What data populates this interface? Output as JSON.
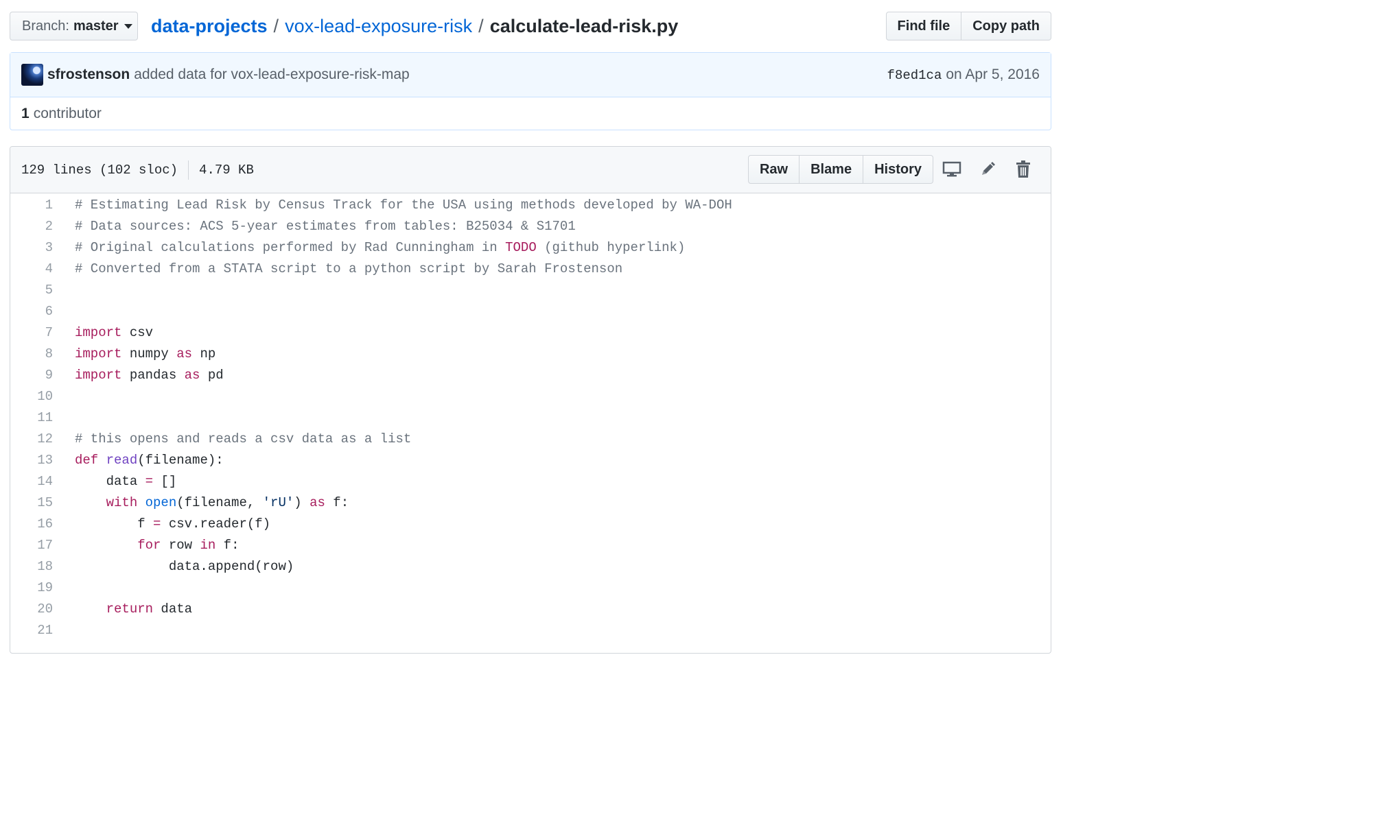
{
  "branch": {
    "label": "Branch:",
    "value": "master"
  },
  "breadcrumb": {
    "repo": "data-projects",
    "folder": "vox-lead-exposure-risk",
    "file": "calculate-lead-risk.py",
    "sep": "/"
  },
  "file_nav": {
    "find_file": "Find file",
    "copy_path": "Copy path"
  },
  "commit": {
    "author": "sfrostenson",
    "message": "added data for vox-lead-exposure-risk-map",
    "sha": "f8ed1ca",
    "date": "on Apr 5, 2016"
  },
  "contributors": {
    "count": "1",
    "label": "contributor"
  },
  "file": {
    "lines": "129 lines (102 sloc)",
    "size": "4.79 KB",
    "actions": {
      "raw": "Raw",
      "blame": "Blame",
      "history": "History"
    },
    "icons": [
      "desktop-icon",
      "pencil-icon",
      "trash-icon"
    ]
  },
  "code": [
    {
      "n": "1",
      "tokens": [
        {
          "t": "# Estimating Lead Risk by Census Track for the USA using methods developed by WA-DOH",
          "c": "comment"
        }
      ]
    },
    {
      "n": "2",
      "tokens": [
        {
          "t": "# Data sources: ACS 5-year estimates from tables: B25034 & S1701",
          "c": "comment"
        }
      ]
    },
    {
      "n": "3",
      "tokens": [
        {
          "t": "# Original calculations performed by Rad Cunningham in ",
          "c": "comment"
        },
        {
          "t": "TODO",
          "c": "todo"
        },
        {
          "t": " (github hyperlink)",
          "c": "comment"
        }
      ]
    },
    {
      "n": "4",
      "tokens": [
        {
          "t": "# Converted from a STATA script to a python script by Sarah Frostenson",
          "c": "comment"
        }
      ]
    },
    {
      "n": "5",
      "tokens": []
    },
    {
      "n": "6",
      "tokens": []
    },
    {
      "n": "7",
      "tokens": [
        {
          "t": "import",
          "c": "kw"
        },
        {
          "t": " csv",
          "c": ""
        }
      ]
    },
    {
      "n": "8",
      "tokens": [
        {
          "t": "import",
          "c": "kw"
        },
        {
          "t": " numpy ",
          "c": ""
        },
        {
          "t": "as",
          "c": "kw"
        },
        {
          "t": " np",
          "c": ""
        }
      ]
    },
    {
      "n": "9",
      "tokens": [
        {
          "t": "import",
          "c": "kw"
        },
        {
          "t": " pandas ",
          "c": ""
        },
        {
          "t": "as",
          "c": "kw"
        },
        {
          "t": " pd",
          "c": ""
        }
      ]
    },
    {
      "n": "10",
      "tokens": []
    },
    {
      "n": "11",
      "tokens": []
    },
    {
      "n": "12",
      "tokens": [
        {
          "t": "# this opens and reads a csv data as a list",
          "c": "comment"
        }
      ]
    },
    {
      "n": "13",
      "tokens": [
        {
          "t": "def",
          "c": "kw"
        },
        {
          "t": " ",
          "c": ""
        },
        {
          "t": "read",
          "c": "fn"
        },
        {
          "t": "(filename):",
          "c": ""
        }
      ]
    },
    {
      "n": "14",
      "tokens": [
        {
          "t": "    data ",
          "c": ""
        },
        {
          "t": "=",
          "c": "kw"
        },
        {
          "t": " []",
          "c": ""
        }
      ]
    },
    {
      "n": "15",
      "tokens": [
        {
          "t": "    ",
          "c": ""
        },
        {
          "t": "with",
          "c": "kw"
        },
        {
          "t": " ",
          "c": ""
        },
        {
          "t": "open",
          "c": "builtin"
        },
        {
          "t": "(filename, ",
          "c": ""
        },
        {
          "t": "'rU'",
          "c": "string"
        },
        {
          "t": ") ",
          "c": ""
        },
        {
          "t": "as",
          "c": "kw"
        },
        {
          "t": " f:",
          "c": ""
        }
      ]
    },
    {
      "n": "16",
      "tokens": [
        {
          "t": "        f ",
          "c": ""
        },
        {
          "t": "=",
          "c": "kw"
        },
        {
          "t": " csv.reader(f)",
          "c": ""
        }
      ]
    },
    {
      "n": "17",
      "tokens": [
        {
          "t": "        ",
          "c": ""
        },
        {
          "t": "for",
          "c": "kw"
        },
        {
          "t": " row ",
          "c": ""
        },
        {
          "t": "in",
          "c": "kw"
        },
        {
          "t": " f:",
          "c": ""
        }
      ]
    },
    {
      "n": "18",
      "tokens": [
        {
          "t": "            data.append(row)",
          "c": ""
        }
      ]
    },
    {
      "n": "19",
      "tokens": []
    },
    {
      "n": "20",
      "tokens": [
        {
          "t": "    ",
          "c": ""
        },
        {
          "t": "return",
          "c": "kw"
        },
        {
          "t": " data",
          "c": ""
        }
      ]
    },
    {
      "n": "21",
      "tokens": []
    }
  ]
}
